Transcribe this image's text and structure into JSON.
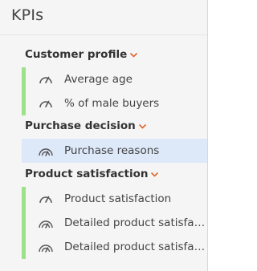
{
  "panel": {
    "title": "KPIs"
  },
  "groups": [
    {
      "label": "Customer profile",
      "items": [
        {
          "label": "Average age",
          "icon": "gauge-icon"
        },
        {
          "label": "% of male buyers",
          "icon": "gauge-icon"
        }
      ]
    },
    {
      "label": "Purchase decision",
      "items": [
        {
          "label": "Purchase reasons",
          "icon": "multi-gauge-icon",
          "selected": true
        }
      ]
    },
    {
      "label": "Product satisfaction",
      "items": [
        {
          "label": "Product satisfaction",
          "icon": "gauge-icon"
        },
        {
          "label": "Detailed product satisfaction",
          "icon": "multi-gauge-icon"
        },
        {
          "label": "Detailed product satisfaction",
          "icon": "multi-gauge-icon"
        }
      ]
    }
  ],
  "colors": {
    "accent_bar": "#9fe08a",
    "chevron": "#e0662a",
    "selected_bg": "#dde8f9"
  }
}
